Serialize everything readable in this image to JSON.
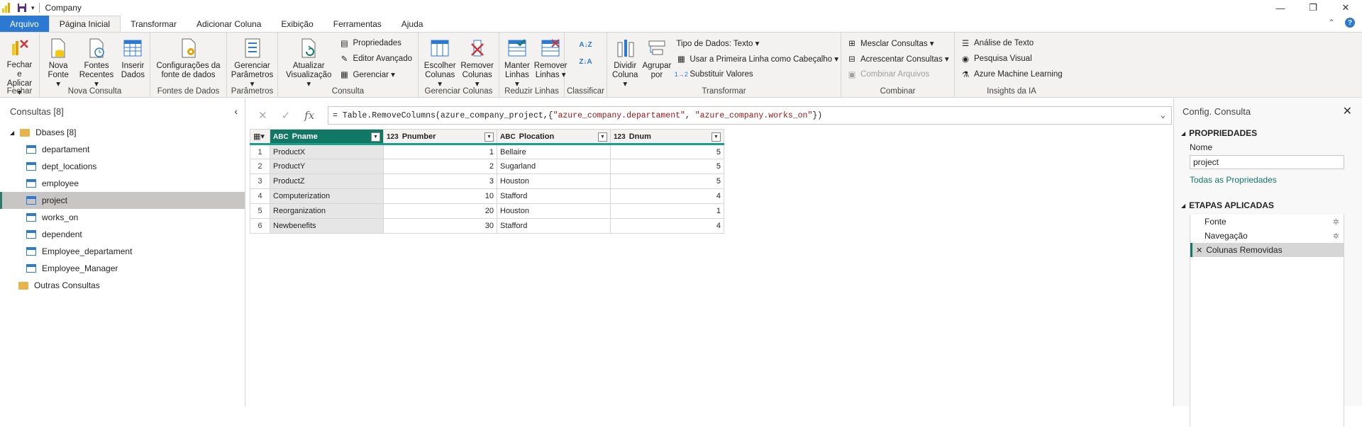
{
  "window": {
    "title": "Company"
  },
  "tabs": [
    "Arquivo",
    "Página Inicial",
    "Transformar",
    "Adicionar Coluna",
    "Exibição",
    "Ferramentas",
    "Ajuda"
  ],
  "ribbon": {
    "fechar": {
      "btn": "Fechar e\nAplicar ▾",
      "label": "Fechar"
    },
    "nova_consulta": {
      "nova_fonte": "Nova\nFonte ▾",
      "fontes_recentes": "Fontes\nRecentes ▾",
      "inserir_dados": "Inserir\nDados",
      "label": "Nova Consulta"
    },
    "fontes": {
      "config": "Configurações da\nfonte de dados",
      "label": "Fontes de Dados"
    },
    "parametros": {
      "gerenciar": "Gerenciar\nParâmetros ▾",
      "label": "Parâmetros"
    },
    "consulta": {
      "atualizar": "Atualizar\nVisualização ▾",
      "propriedades": "Propriedades",
      "editor": "Editor Avançado",
      "gerenciar": "Gerenciar ▾",
      "label": "Consulta"
    },
    "colunas": {
      "escolher": "Escolher\nColunas ▾",
      "remover": "Remover\nColunas ▾",
      "label": "Gerenciar Colunas"
    },
    "linhas": {
      "manter": "Manter\nLinhas ▾",
      "remover": "Remover\nLinhas ▾",
      "label": "Reduzir Linhas"
    },
    "classificar": {
      "label": "Classificar"
    },
    "transformar": {
      "dividir": "Dividir\nColuna ▾",
      "agrupar": "Agrupar\npor",
      "tipo": "Tipo de Dados: Texto ▾",
      "primeira_linha": "Usar a Primeira Linha como Cabeçalho ▾",
      "substituir": "Substituir Valores",
      "label": "Transformar"
    },
    "combinar": {
      "mesclar": "Mesclar Consultas ▾",
      "acrescentar": "Acrescentar Consultas ▾",
      "combinar_arquivos": "Combinar Arquivos",
      "label": "Combinar"
    },
    "ia": {
      "texto": "Análise de Texto",
      "visual": "Pesquisa Visual",
      "ml": "Azure Machine Learning",
      "label": "Insights da IA"
    }
  },
  "queries": {
    "header": "Consultas [8]",
    "folder": "Dbases [8]",
    "items": [
      "departament",
      "dept_locations",
      "employee",
      "project",
      "works_on",
      "dependent",
      "Employee_departament",
      "Employee_Manager"
    ],
    "selected": "project",
    "other": "Outras Consultas"
  },
  "formula": {
    "prefix": "= Table.RemoveColumns(azure_company_project,{",
    "arg1": "\"azure_company.departament\"",
    "sep": ", ",
    "arg2": "\"azure_company.works_on\"",
    "suffix": "})"
  },
  "table": {
    "columns": [
      {
        "name": "Pname",
        "type": "ABC"
      },
      {
        "name": "Pnumber",
        "type": "123"
      },
      {
        "name": "Plocation",
        "type": "ABC"
      },
      {
        "name": "Dnum",
        "type": "123"
      }
    ],
    "rows": [
      [
        "1",
        "ProductX",
        "1",
        "Bellaire",
        "5"
      ],
      [
        "2",
        "ProductY",
        "2",
        "Sugarland",
        "5"
      ],
      [
        "3",
        "ProductZ",
        "3",
        "Houston",
        "5"
      ],
      [
        "4",
        "Computerization",
        "10",
        "Stafford",
        "4"
      ],
      [
        "5",
        "Reorganization",
        "20",
        "Houston",
        "1"
      ],
      [
        "6",
        "Newbenefits",
        "30",
        "Stafford",
        "4"
      ]
    ]
  },
  "settings": {
    "title": "Config. Consulta",
    "propriedades": "PROPRIEDADES",
    "nome_label": "Nome",
    "nome_value": "project",
    "todas": "Todas as Propriedades",
    "etapas": "ETAPAS APLICADAS",
    "steps": [
      "Fonte",
      "Navegação",
      "Colunas Removidas"
    ]
  },
  "colors": {
    "accent": "#117865",
    "file_tab": "#2b79d0",
    "folder": "#e8b24c"
  }
}
